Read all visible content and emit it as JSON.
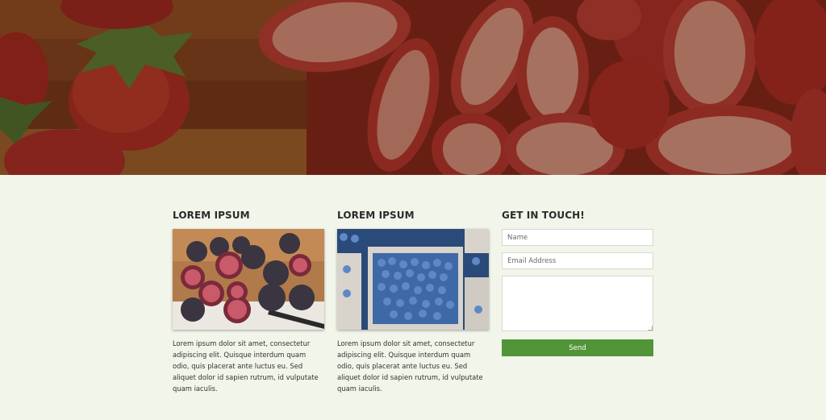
{
  "hero": {
    "image": "strawberries-photo"
  },
  "columns": [
    {
      "heading": "LOREM IPSUM",
      "image": "figs-photo",
      "text": "Lorem ipsum dolor sit amet, consectetur adipiscing elit. Quisque interdum quam odio, quis placerat ante luctus eu. Sed aliquet dolor id sapien rutrum, id vulputate quam iaculis."
    },
    {
      "heading": "LOREM IPSUM",
      "image": "blueberries-photo",
      "text": "Lorem ipsum dolor sit amet, consectetur adipiscing elit. Quisque interdum quam odio, quis placerat ante luctus eu. Sed aliquet dolor id sapien rutrum, id vulputate quam iaculis."
    }
  ],
  "contact": {
    "heading": "GET IN TOUCH!",
    "name_placeholder": "Name",
    "email_placeholder": "Email Address",
    "message_placeholder": "",
    "send_label": "Send"
  },
  "colors": {
    "page_background": "#f2f5ea",
    "send_button": "#529539",
    "heading_text": "#2b2b2b"
  }
}
